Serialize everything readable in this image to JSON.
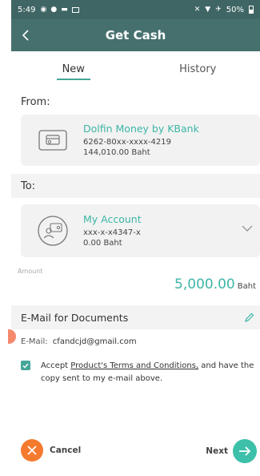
{
  "status_bar": {
    "time": "5:49",
    "battery": "50%"
  },
  "header": {
    "title": "Get Cash"
  },
  "tabs": [
    {
      "label": "New"
    },
    {
      "label": "History"
    }
  ],
  "from": {
    "label": "From:",
    "account_name": "Dolfin Money by KBank",
    "account_number": "6262-80xx-xxxx-4219",
    "balance": "144,010.00  Baht"
  },
  "to": {
    "label": "To:",
    "account_name": "My Account",
    "account_number": "xxx-x-x4347-x",
    "balance": "0.00  Baht"
  },
  "amount": {
    "label": "Amount",
    "value": "5,000.00",
    "unit": "Baht"
  },
  "email_section": {
    "title": "E-Mail for Documents",
    "email_label": "E-Mail:",
    "email_value": "cfandcjd@gmail.com",
    "accept_prefix": "Accept ",
    "accept_link": "Product's Terms and Conditions,",
    "accept_suffix": " and have the copy sent to my e-mail above."
  },
  "actions": {
    "cancel_label": "Cancel",
    "next_label": "Next"
  },
  "colors": {
    "header": "#46706e",
    "accent": "#3db6a6",
    "cancel": "#f47a2f",
    "next": "#3cc0aa"
  }
}
